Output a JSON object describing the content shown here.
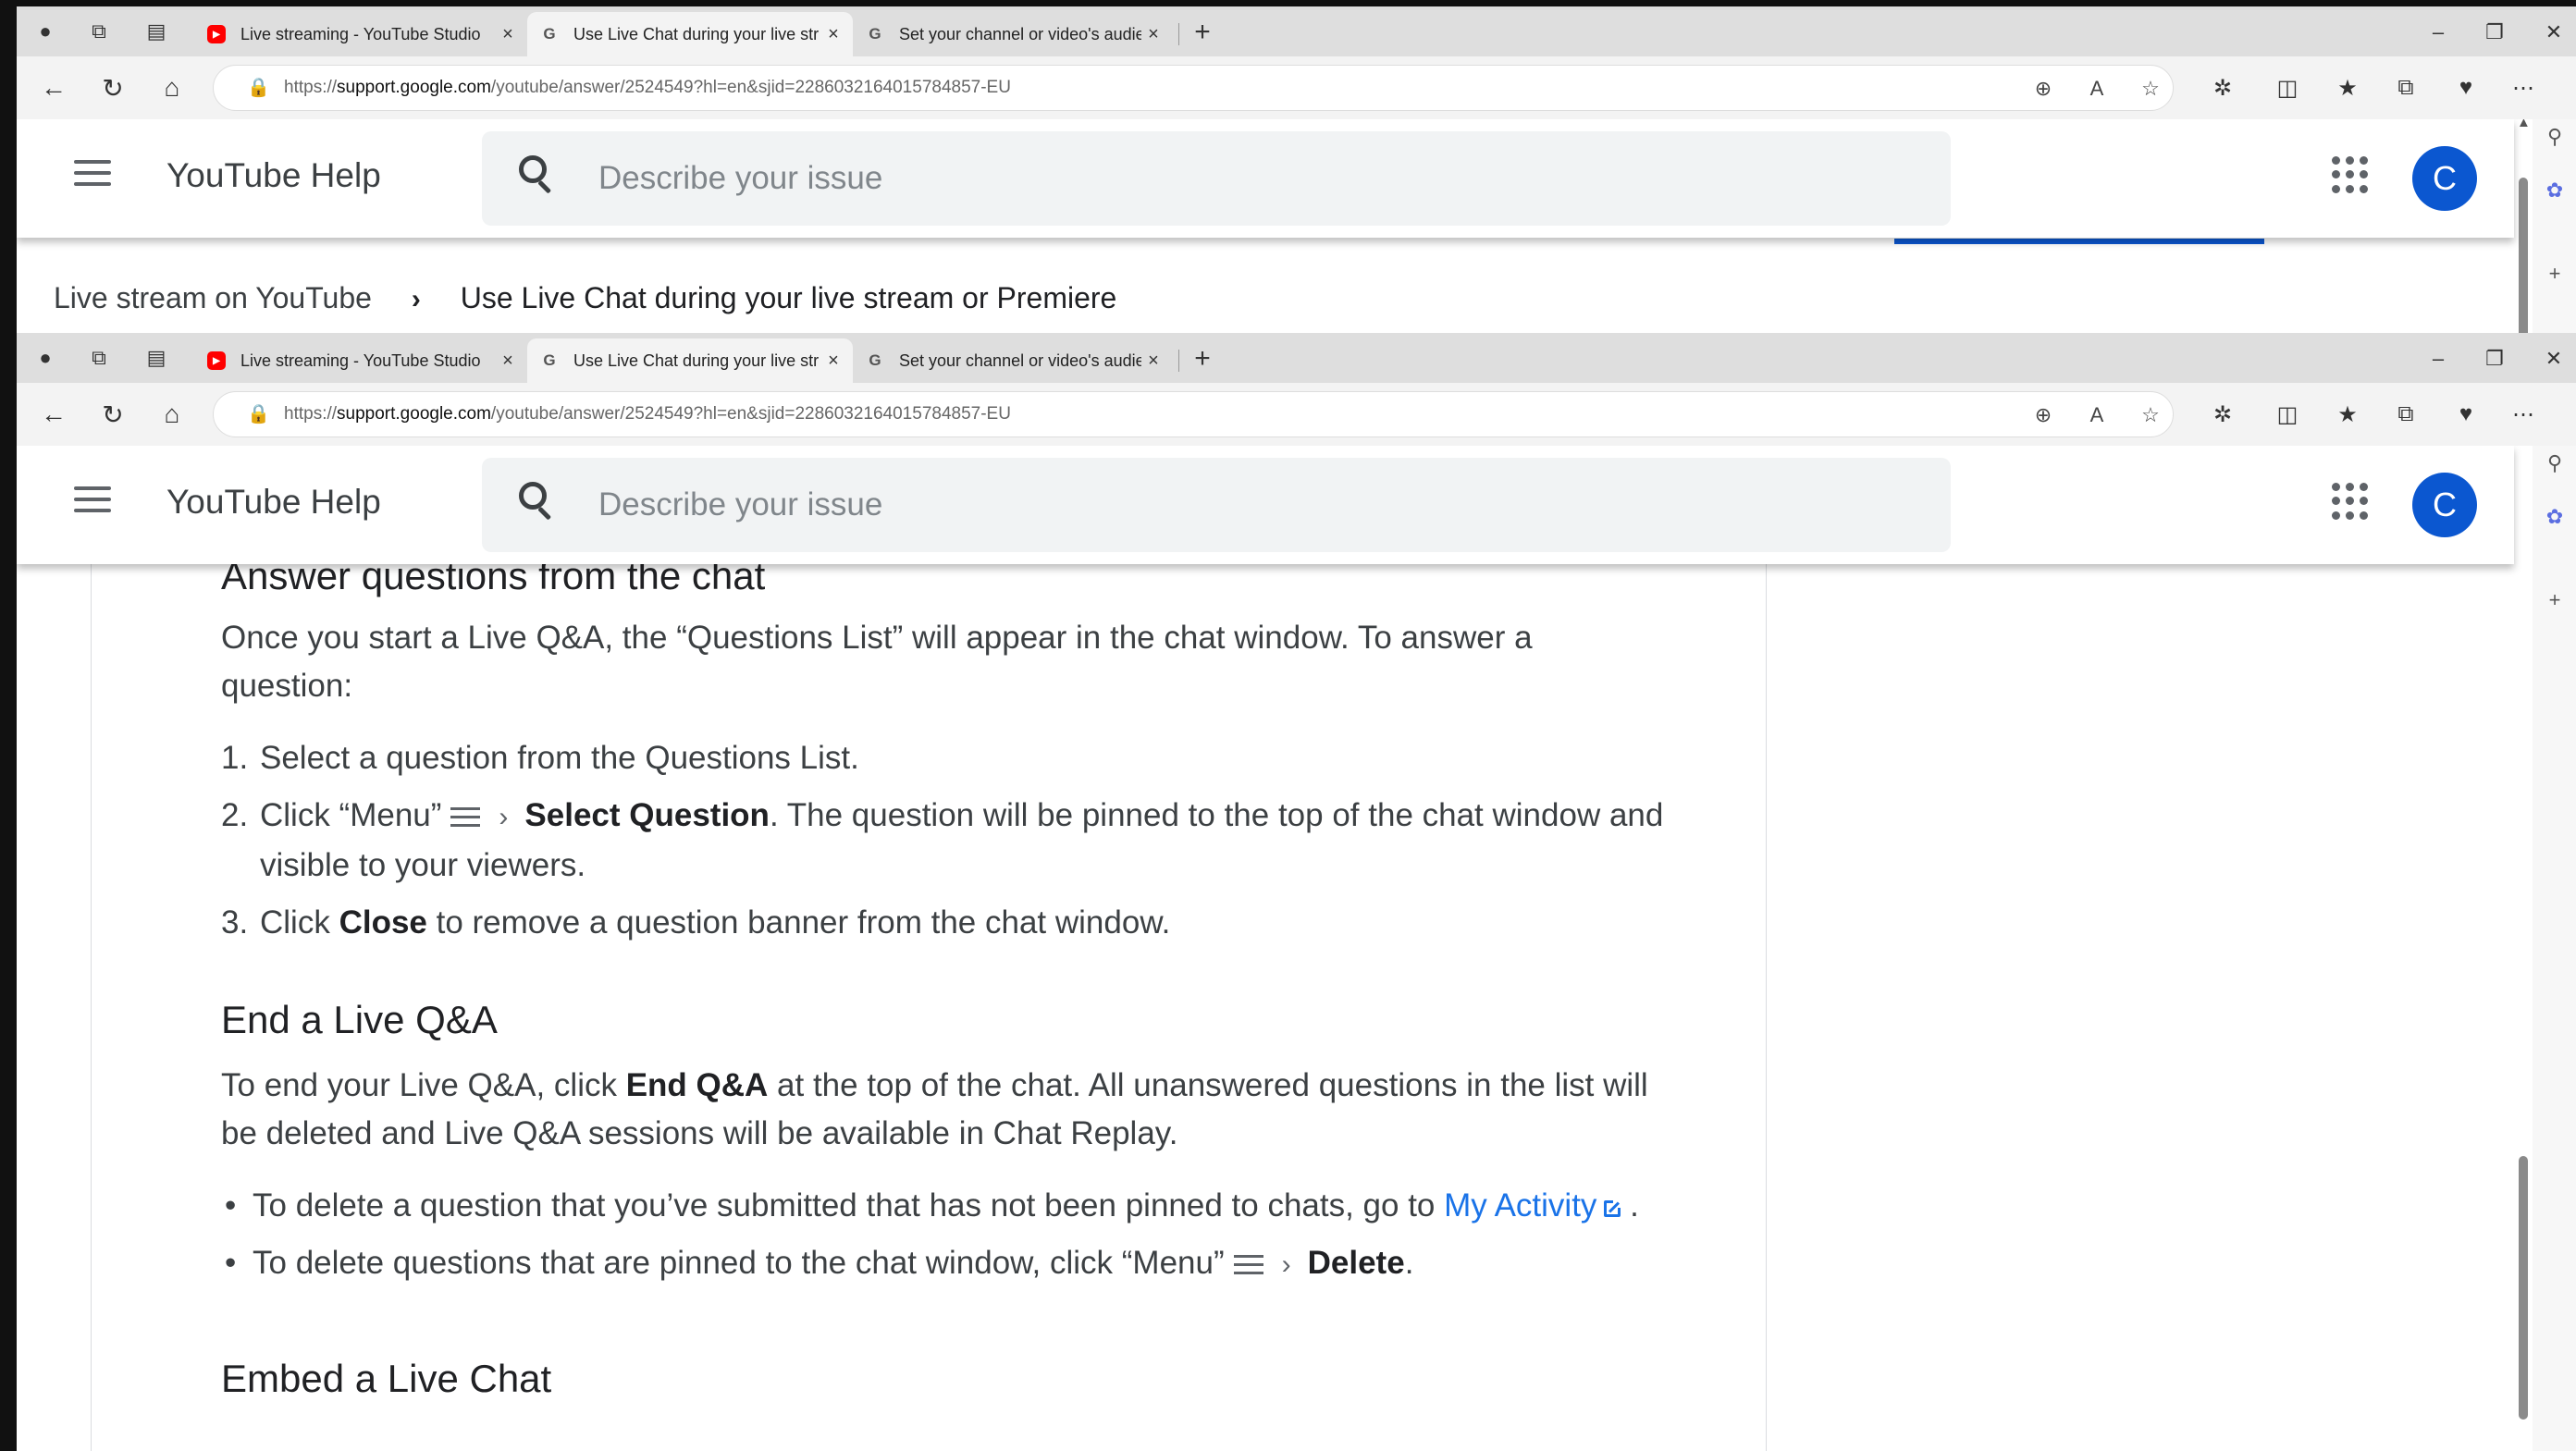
{
  "browser": {
    "tabs": [
      {
        "title": "Live streaming - YouTube Studio",
        "favicon": "youtube-icon"
      },
      {
        "title": "Use Live Chat during your live str",
        "favicon": "google-icon"
      },
      {
        "title": "Set your channel or video's audie",
        "favicon": "google-icon"
      }
    ],
    "url_prefix": "https://",
    "url_host": "support.google.com",
    "url_path": "/youtube/answer/2524549?hl=en&sjid=2286032164015784857-EU"
  },
  "site": {
    "title": "YouTube Help",
    "search_placeholder": "Describe your issue",
    "avatar_letter": "C"
  },
  "breadcrumb": {
    "parent": "Live stream on YouTube",
    "current": "Use Live Chat during your live stream or Premiere"
  },
  "article": {
    "section1_title": "Answer questions from the chat",
    "section1_intro": "Once you start a Live Q&A, the “Questions List” will appear in the chat window. To answer a question:",
    "steps": [
      {
        "num": "1.",
        "text": "Select a question from the Questions List."
      },
      {
        "num": "2.",
        "pre": "Click “Menu”",
        "bold": "Select Question",
        "post": ". The question will be pinned to the top of the chat window and visible to your viewers."
      },
      {
        "num": "3.",
        "pre": "Click ",
        "bold": "Close",
        "post": " to remove a question banner from the chat window."
      }
    ],
    "section2_title": "End a Live Q&A",
    "section2_pre": "To end your Live Q&A, click ",
    "section2_bold": "End Q&A",
    "section2_post": " at the top of the chat. All unanswered questions in the list will be deleted and Live Q&A sessions will be available in Chat Replay.",
    "bullets": [
      {
        "pre": "To delete a question that you’ve submitted that has not been pinned to chats, go to ",
        "link": "My Activity",
        "post": " ."
      },
      {
        "pre": "To delete questions that are pinned to the chat window, click “Menu”",
        "bold": "Delete",
        "post": "."
      }
    ],
    "section3_title": "Embed a Live Chat"
  },
  "colors": {
    "accent": "#0b57d0",
    "link": "#1a73e8",
    "text": "#3c4043"
  }
}
